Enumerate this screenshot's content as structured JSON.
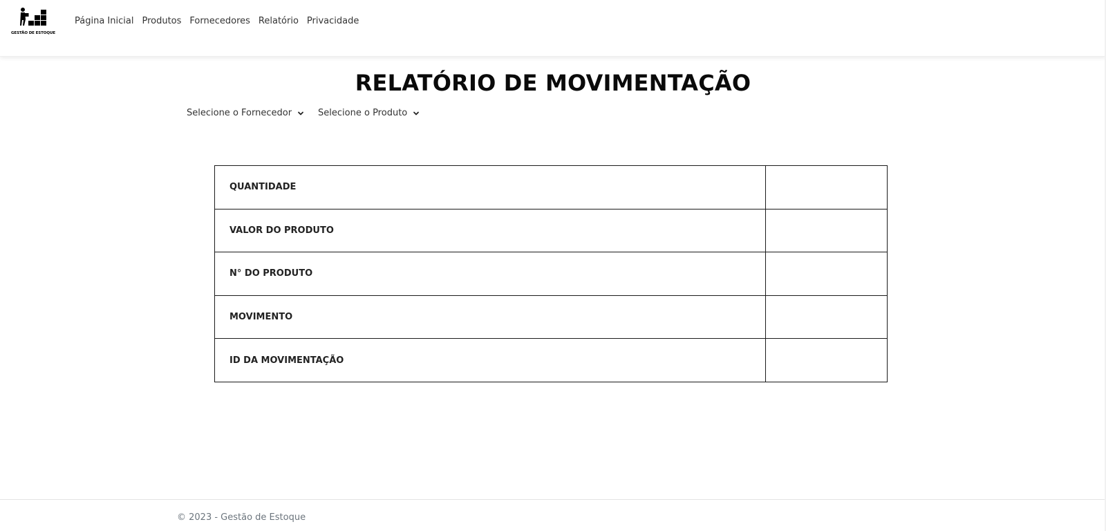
{
  "brand": {
    "name": "GESTÃO DE ESTOQUE",
    "icon": "warehouse-worker-boxes-icon"
  },
  "nav": {
    "items": [
      {
        "label": "Página Inicial"
      },
      {
        "label": "Produtos"
      },
      {
        "label": "Fornecedores"
      },
      {
        "label": "Relatório"
      },
      {
        "label": "Privacidade"
      }
    ]
  },
  "page": {
    "title": "RELATÓRIO DE MOVIMENTAÇÃO"
  },
  "filters": {
    "supplier": {
      "label": "Selecione o Fornecedor",
      "icon": "chevron-down-icon"
    },
    "product": {
      "label": "Selecione o Produto",
      "icon": "chevron-down-icon"
    }
  },
  "report": {
    "rows": [
      {
        "label": "QUANTIDADE",
        "value": ""
      },
      {
        "label": "VALOR DO PRODUTO",
        "value": ""
      },
      {
        "label": "N° DO PRODUTO",
        "value": ""
      },
      {
        "label": "MOVIMENTO",
        "value": ""
      },
      {
        "label": "ID DA MOVIMENTAÇÃO",
        "value": ""
      }
    ]
  },
  "footer": {
    "text": "© 2023 - Gestão de Estoque"
  }
}
